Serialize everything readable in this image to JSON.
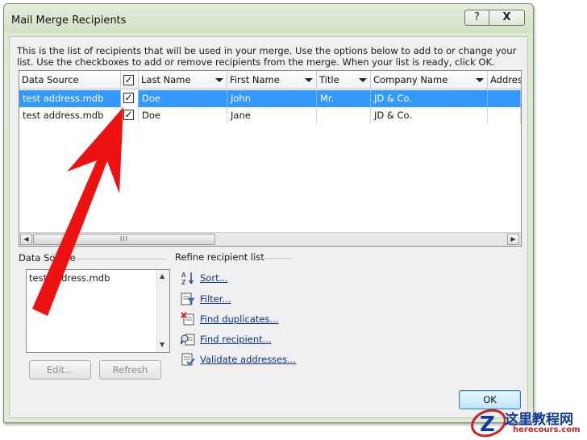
{
  "window": {
    "title": "Mail Merge Recipients",
    "help_glyph": "?",
    "close_glyph": "X"
  },
  "intro_text": "This is the list of recipients that will be used in your merge.  Use the options below to add to or change your list.  Use the checkboxes to add or remove recipients from the merge.  When your list is ready, click OK.",
  "grid": {
    "columns": [
      "Data Source",
      "",
      "Last Name",
      "First Name",
      "Title",
      "Company Name",
      "Address"
    ],
    "header_check_glyph": "✓",
    "rows": [
      {
        "data_source": "test address.mdb",
        "checked": "✓",
        "last_name": "Doe",
        "first_name": "John",
        "title": "Mr.",
        "company": "JD & Co.",
        "selected": true
      },
      {
        "data_source": "test address.mdb",
        "checked": "✓",
        "last_name": "Doe",
        "first_name": "Jane",
        "title": "",
        "company": "JD & Co.",
        "selected": false
      }
    ],
    "scroll_thumb_glyph": "III",
    "scroll_left_glyph": "◀",
    "scroll_right_glyph": "▶"
  },
  "data_source_group": {
    "label": "Data Source",
    "items": [
      "test address.mdb"
    ],
    "edit_button": "Edit...",
    "refresh_button": "Refresh"
  },
  "refine": {
    "label": "Refine recipient list",
    "links": [
      {
        "label": "Sort...",
        "icon": "sort-az-icon"
      },
      {
        "label": "Filter...",
        "icon": "filter-icon"
      },
      {
        "label": "Find duplicates...",
        "icon": "find-duplicates-icon"
      },
      {
        "label": "Find recipient...",
        "icon": "find-recipient-icon"
      },
      {
        "label": "Validate addresses...",
        "icon": "validate-addresses-icon"
      }
    ]
  },
  "ok_button": "OK",
  "watermark": {
    "text_cn": "这里教程网",
    "text_en": "herecours.com"
  },
  "colors": {
    "selection": "#3399ff",
    "link": "#0a2f9e",
    "annotation_arrow": "#ee1111",
    "dialog_frame": "#dfe9d3"
  }
}
